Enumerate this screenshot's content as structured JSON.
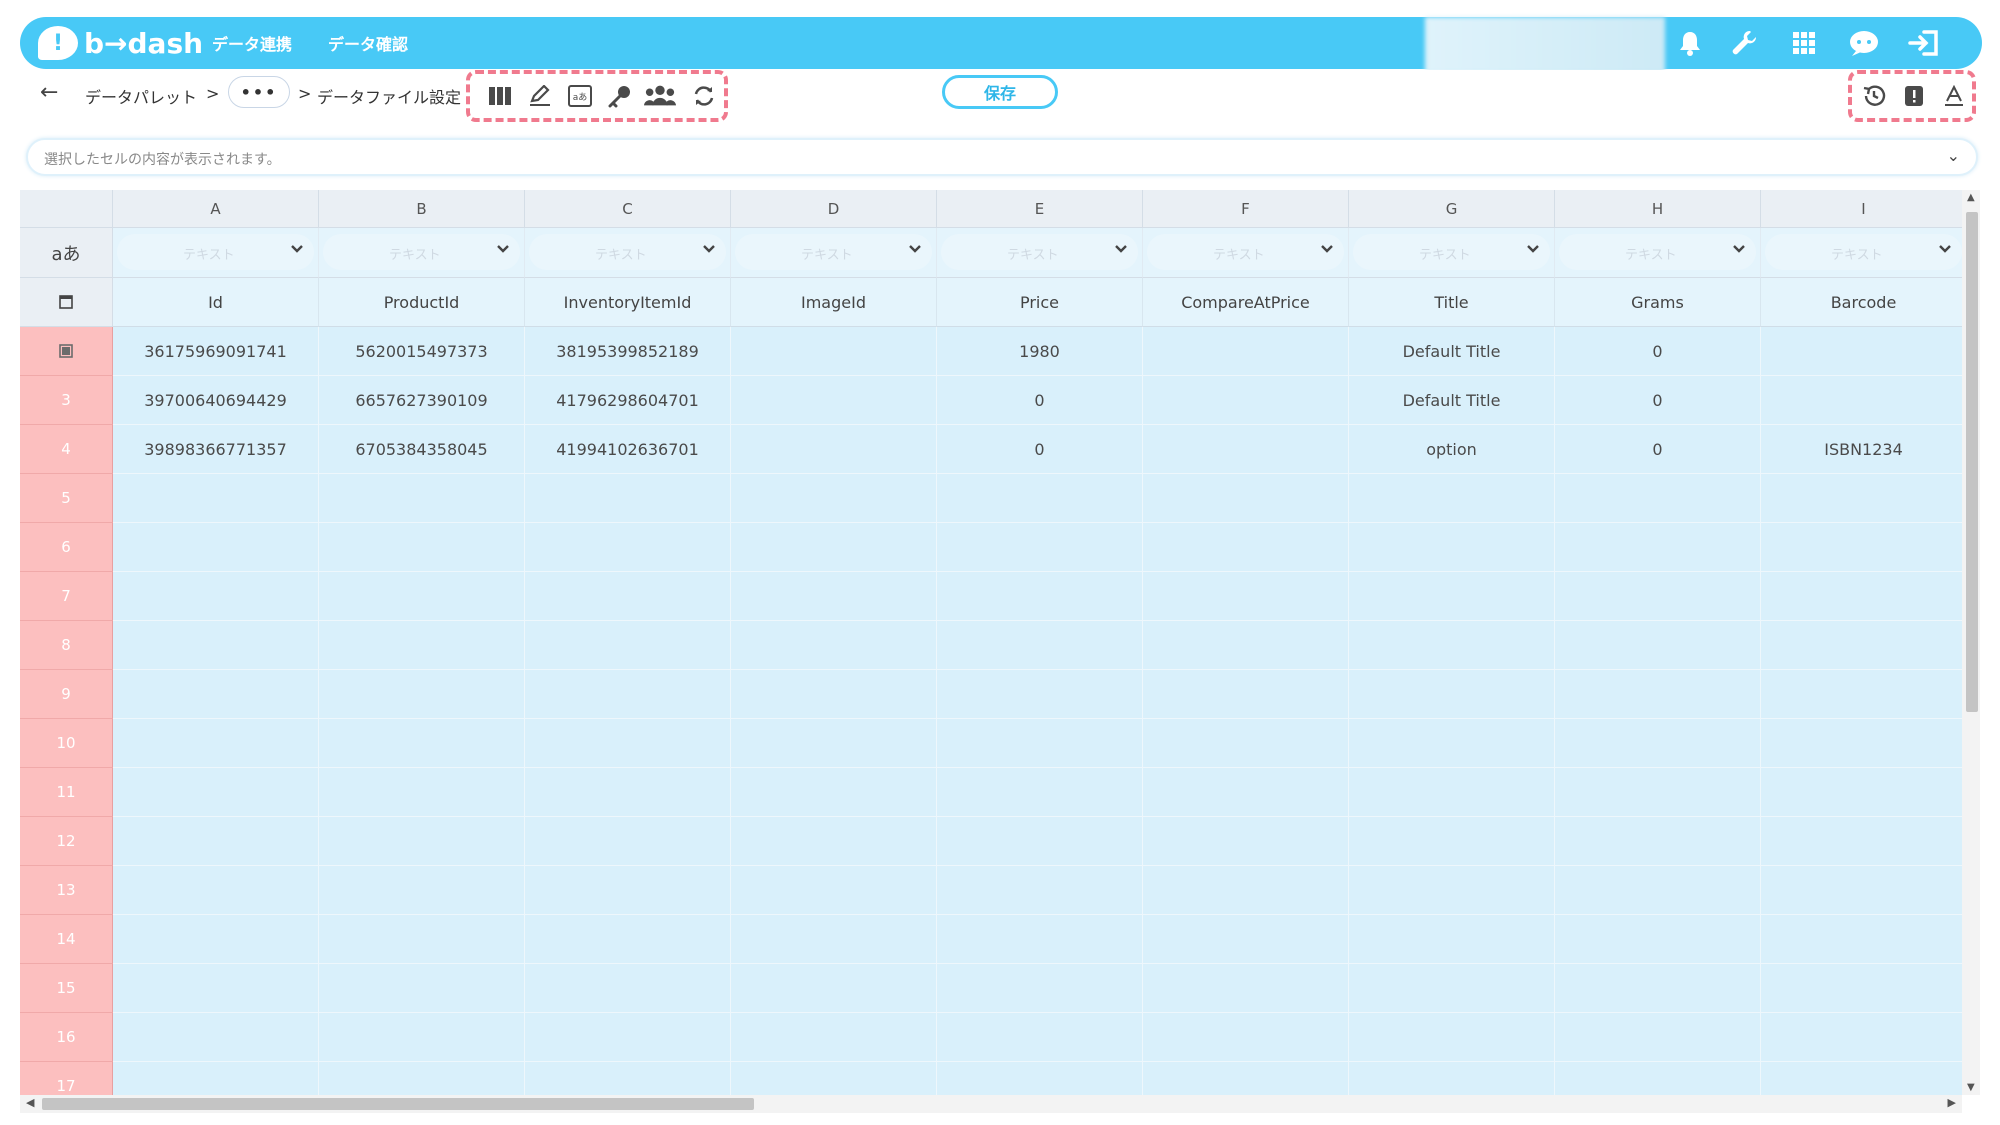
{
  "header": {
    "logo_mark": "!",
    "logo_text": "b→dash",
    "nav": [
      "データ連携",
      "データ確認"
    ],
    "icons": [
      "bell-icon",
      "wrench-icon",
      "grid-icon",
      "chat-icon",
      "logout-icon"
    ]
  },
  "toolbar": {
    "back_icon": "←",
    "breadcrumb": [
      "データパレット",
      ">",
      "•••",
      ">",
      "データファイル設定"
    ],
    "tools": [
      "columns-icon",
      "edit-icon",
      "text-type-icon",
      "key-icon",
      "users-icon",
      "refresh-icon"
    ],
    "save_label": "保存",
    "right_tools": [
      "history-icon",
      "alert-icon",
      "font-icon"
    ],
    "accent_color": "#48c9f6",
    "highlight_color": "#f07a8e"
  },
  "cell_bar": {
    "placeholder": "選択したセルの内容が表示されます。"
  },
  "grid": {
    "type_row_label": "aあ",
    "type_placeholder": "テキスト",
    "columns": [
      {
        "letter": "A",
        "field": "Id"
      },
      {
        "letter": "B",
        "field": "ProductId"
      },
      {
        "letter": "C",
        "field": "InventoryItemId"
      },
      {
        "letter": "D",
        "field": "ImageId"
      },
      {
        "letter": "E",
        "field": "Price"
      },
      {
        "letter": "F",
        "field": "CompareAtPrice"
      },
      {
        "letter": "G",
        "field": "Title"
      },
      {
        "letter": "H",
        "field": "Grams"
      },
      {
        "letter": "I",
        "field": "Barcode"
      }
    ],
    "rows": [
      {
        "num": "",
        "cells": [
          "36175969091741",
          "5620015497373",
          "38195399852189",
          "",
          "1980",
          "",
          "Default Title",
          "0",
          ""
        ]
      },
      {
        "num": "3",
        "cells": [
          "39700640694429",
          "6657627390109",
          "41796298604701",
          "",
          "0",
          "",
          "Default Title",
          "0",
          ""
        ]
      },
      {
        "num": "4",
        "cells": [
          "39898366771357",
          "6705384358045",
          "41994102636701",
          "",
          "0",
          "",
          "option",
          "0",
          "ISBN1234"
        ]
      },
      {
        "num": "5",
        "cells": [
          "",
          "",
          "",
          "",
          "",
          "",
          "",
          "",
          ""
        ]
      },
      {
        "num": "6",
        "cells": [
          "",
          "",
          "",
          "",
          "",
          "",
          "",
          "",
          ""
        ]
      },
      {
        "num": "7",
        "cells": [
          "",
          "",
          "",
          "",
          "",
          "",
          "",
          "",
          ""
        ]
      },
      {
        "num": "8",
        "cells": [
          "",
          "",
          "",
          "",
          "",
          "",
          "",
          "",
          ""
        ]
      },
      {
        "num": "9",
        "cells": [
          "",
          "",
          "",
          "",
          "",
          "",
          "",
          "",
          ""
        ]
      },
      {
        "num": "10",
        "cells": [
          "",
          "",
          "",
          "",
          "",
          "",
          "",
          "",
          ""
        ]
      },
      {
        "num": "11",
        "cells": [
          "",
          "",
          "",
          "",
          "",
          "",
          "",
          "",
          ""
        ]
      },
      {
        "num": "12",
        "cells": [
          "",
          "",
          "",
          "",
          "",
          "",
          "",
          "",
          ""
        ]
      },
      {
        "num": "13",
        "cells": [
          "",
          "",
          "",
          "",
          "",
          "",
          "",
          "",
          ""
        ]
      },
      {
        "num": "14",
        "cells": [
          "",
          "",
          "",
          "",
          "",
          "",
          "",
          "",
          ""
        ]
      },
      {
        "num": "15",
        "cells": [
          "",
          "",
          "",
          "",
          "",
          "",
          "",
          "",
          ""
        ]
      },
      {
        "num": "16",
        "cells": [
          "",
          "",
          "",
          "",
          "",
          "",
          "",
          "",
          ""
        ]
      },
      {
        "num": "17",
        "cells": [
          "",
          "",
          "",
          "",
          "",
          "",
          "",
          "",
          ""
        ]
      }
    ]
  }
}
